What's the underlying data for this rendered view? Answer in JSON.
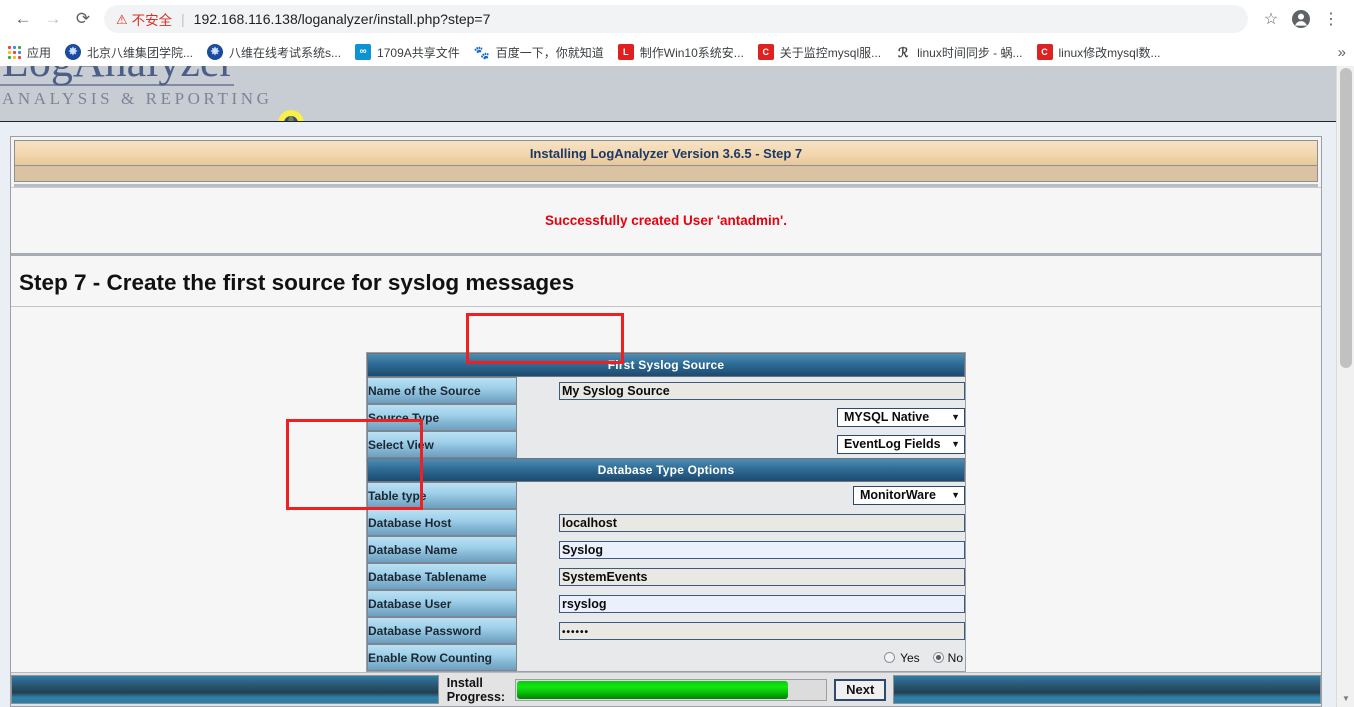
{
  "browser": {
    "back_icon": "back-arrow-icon",
    "forward_icon": "forward-arrow-icon",
    "reload_icon": "reload-icon",
    "security_warning": "不安全",
    "url": "192.168.116.138/loganalyzer/install.php?step=7",
    "star_icon": "bookmark-star-icon",
    "profile_icon": "profile-avatar-icon",
    "menu_icon": "three-dot-menu-icon",
    "bookmarks": [
      {
        "label": "应用",
        "icon": "apps-grid-icon"
      },
      {
        "label": "北京八维集团学院...",
        "icon": "globe-icon"
      },
      {
        "label": "八维在线考试系统s...",
        "icon": "globe-icon"
      },
      {
        "label": "1709A共享文件",
        "icon": "infinity-icon"
      },
      {
        "label": "百度一下，你就知道",
        "icon": "baidu-paw-icon"
      },
      {
        "label": "制作Win10系统安...",
        "icon": "l-red-icon"
      },
      {
        "label": "关于监控mysql服...",
        "icon": "csdn-c-icon"
      },
      {
        "label": "linux时间同步 - 蜗...",
        "icon": "script-icon"
      },
      {
        "label": "linux修改mysql数...",
        "icon": "csdn-c-icon"
      }
    ],
    "overflow_icon": "chevron-double-right-icon"
  },
  "logo": {
    "title": "LogAnalyzer",
    "subtitle": "ANALYSIS & REPORTING",
    "globe_icon": "yellow-globe-icon"
  },
  "installer": {
    "title_bar": "Installing LogAnalyzer Version 3.6.5 - Step 7",
    "message": "Successfully created User 'antadmin'.",
    "step_heading": "Step 7 - Create the first source for syslog messages"
  },
  "form": {
    "section1_title": "First Syslog Source",
    "section2_title": "Database Type Options",
    "rows1": [
      {
        "label": "Name of the Source",
        "type": "text",
        "value": "My Syslog Source"
      },
      {
        "label": "Source Type",
        "type": "select",
        "value": "MYSQL Native"
      },
      {
        "label": "Select View",
        "type": "select",
        "value": "EventLog Fields"
      }
    ],
    "rows2": [
      {
        "label": "Table type",
        "type": "select",
        "value": "MonitorWare"
      },
      {
        "label": "Database Host",
        "type": "text",
        "value": "localhost"
      },
      {
        "label": "Database Name",
        "type": "text",
        "value": "Syslog"
      },
      {
        "label": "Database Tablename",
        "type": "text",
        "value": "SystemEvents"
      },
      {
        "label": "Database User",
        "type": "text",
        "value": "rsyslog"
      },
      {
        "label": "Database Password",
        "type": "password",
        "value": "••••••"
      },
      {
        "label": "Enable Row Counting",
        "type": "radio",
        "value": "No"
      }
    ],
    "radio_yes": "Yes",
    "radio_no": "No",
    "caret": "▼"
  },
  "footer": {
    "progress_label_line1": "Install",
    "progress_label_line2": "Progress:",
    "progress_percent": 88,
    "next_label": "Next"
  },
  "colors": {
    "accent_blue": "#2e6c95",
    "label_blue": "#9fd0ea",
    "title_tan": "#f3d7ae",
    "message_red": "#e8000d",
    "highlight_red": "#f02020",
    "progress_green": "#13e813"
  }
}
